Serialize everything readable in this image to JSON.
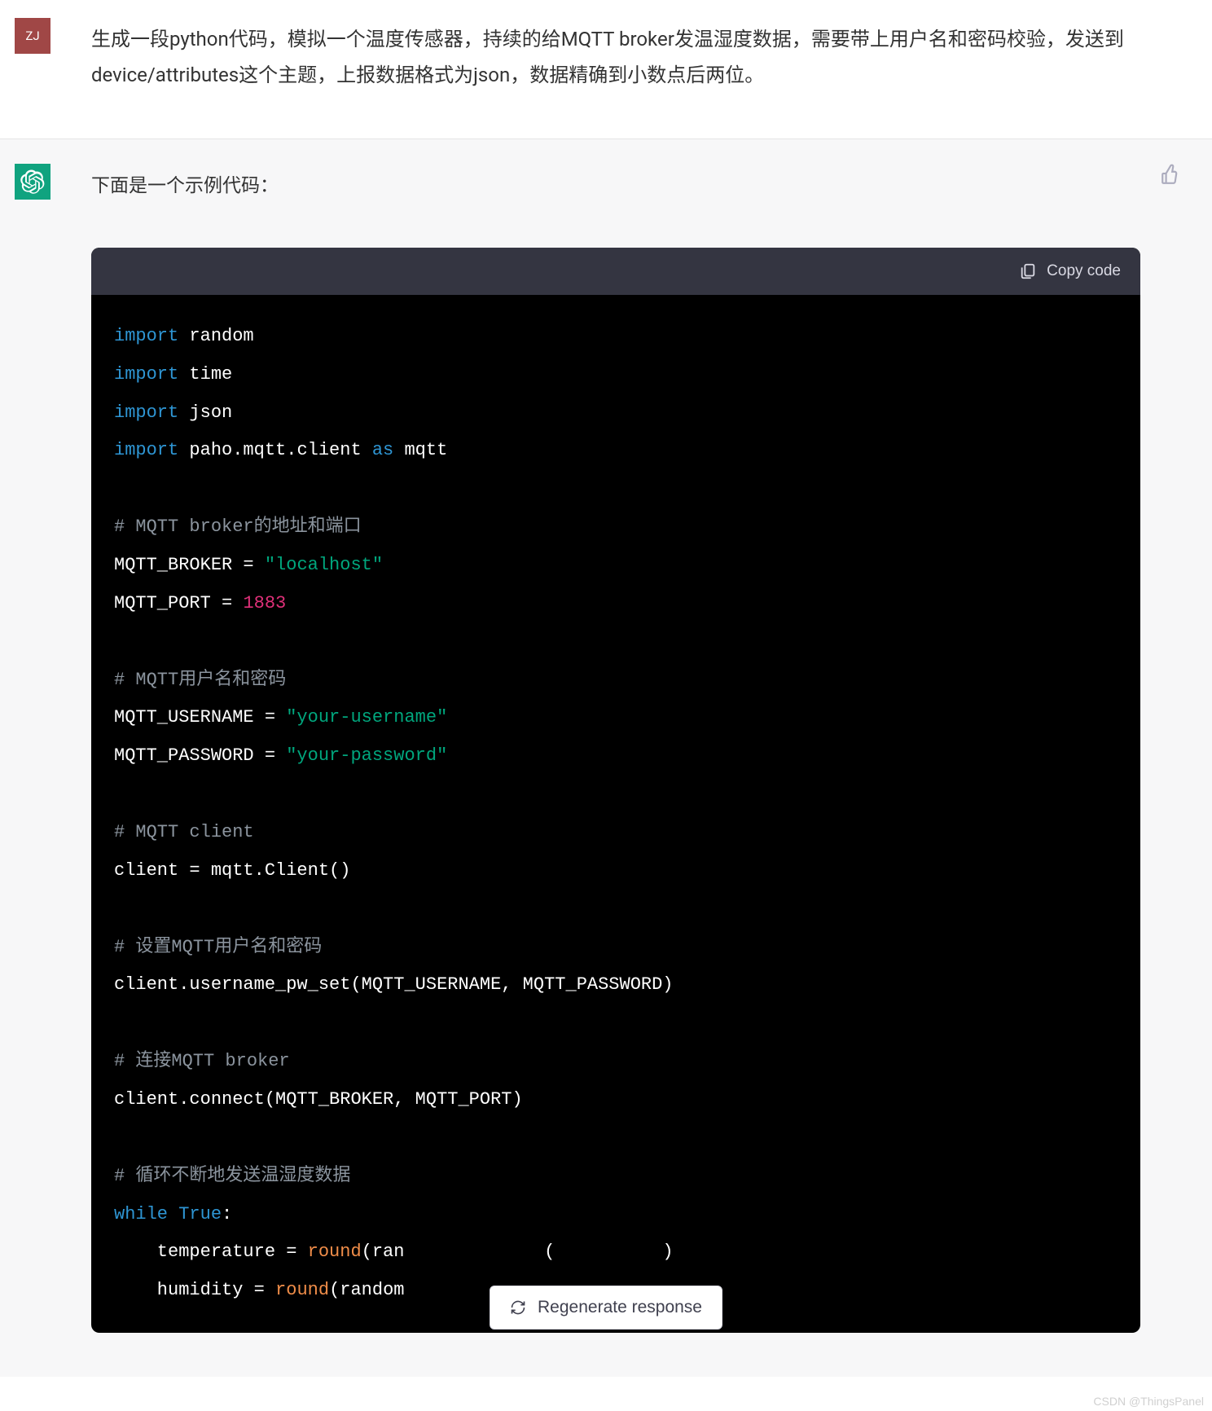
{
  "user": {
    "avatar_text": "ZJ",
    "message": "生成一段python代码，模拟一个温度传感器，持续的给MQTT broker发温湿度数据，需要带上用户名和密码校验，发送到device/attributes这个主题，上报数据格式为json，数据精确到小数点后两位。"
  },
  "assistant": {
    "intro": "下面是一个示例代码：",
    "copy_label": "Copy code",
    "code": {
      "lines": [
        {
          "t": "stmt",
          "parts": [
            {
              "c": "kw",
              "v": "import"
            },
            {
              "c": "id",
              "v": " random"
            }
          ]
        },
        {
          "t": "stmt",
          "parts": [
            {
              "c": "kw",
              "v": "import"
            },
            {
              "c": "id",
              "v": " time"
            }
          ]
        },
        {
          "t": "stmt",
          "parts": [
            {
              "c": "kw",
              "v": "import"
            },
            {
              "c": "id",
              "v": " json"
            }
          ]
        },
        {
          "t": "stmt",
          "parts": [
            {
              "c": "kw",
              "v": "import"
            },
            {
              "c": "id",
              "v": " paho.mqtt.client "
            },
            {
              "c": "kw",
              "v": "as"
            },
            {
              "c": "id",
              "v": " mqtt"
            }
          ]
        },
        {
          "t": "blank"
        },
        {
          "t": "stmt",
          "parts": [
            {
              "c": "cmt",
              "v": "# MQTT broker的地址和端口"
            }
          ]
        },
        {
          "t": "stmt",
          "parts": [
            {
              "c": "id",
              "v": "MQTT_BROKER = "
            },
            {
              "c": "str",
              "v": "\"localhost\""
            }
          ]
        },
        {
          "t": "stmt",
          "parts": [
            {
              "c": "id",
              "v": "MQTT_PORT = "
            },
            {
              "c": "num",
              "v": "1883"
            }
          ]
        },
        {
          "t": "blank"
        },
        {
          "t": "stmt",
          "parts": [
            {
              "c": "cmt",
              "v": "# MQTT用户名和密码"
            }
          ]
        },
        {
          "t": "stmt",
          "parts": [
            {
              "c": "id",
              "v": "MQTT_USERNAME = "
            },
            {
              "c": "str",
              "v": "\"your-username\""
            }
          ]
        },
        {
          "t": "stmt",
          "parts": [
            {
              "c": "id",
              "v": "MQTT_PASSWORD = "
            },
            {
              "c": "str",
              "v": "\"your-password\""
            }
          ]
        },
        {
          "t": "blank"
        },
        {
          "t": "stmt",
          "parts": [
            {
              "c": "cmt",
              "v": "# MQTT client"
            }
          ]
        },
        {
          "t": "stmt",
          "parts": [
            {
              "c": "id",
              "v": "client = mqtt.Client()"
            }
          ]
        },
        {
          "t": "blank"
        },
        {
          "t": "stmt",
          "parts": [
            {
              "c": "cmt",
              "v": "# 设置MQTT用户名和密码"
            }
          ]
        },
        {
          "t": "stmt",
          "parts": [
            {
              "c": "id",
              "v": "client.username_pw_set(MQTT_USERNAME, MQTT_PASSWORD)"
            }
          ]
        },
        {
          "t": "blank"
        },
        {
          "t": "stmt",
          "parts": [
            {
              "c": "cmt",
              "v": "# 连接MQTT broker"
            }
          ]
        },
        {
          "t": "stmt",
          "parts": [
            {
              "c": "id",
              "v": "client.connect(MQTT_BROKER, MQTT_PORT)"
            }
          ]
        },
        {
          "t": "blank"
        },
        {
          "t": "stmt",
          "parts": [
            {
              "c": "cmt",
              "v": "# 循环不断地发送温湿度数据"
            }
          ]
        },
        {
          "t": "stmt",
          "parts": [
            {
              "c": "kw",
              "v": "while"
            },
            {
              "c": "id",
              "v": " "
            },
            {
              "c": "kw",
              "v": "True"
            },
            {
              "c": "id",
              "v": ":"
            }
          ]
        },
        {
          "t": "stmt",
          "parts": [
            {
              "c": "id",
              "v": "    temperature = "
            },
            {
              "c": "fn",
              "v": "round"
            },
            {
              "c": "id",
              "v": "(ran             (          )"
            }
          ]
        },
        {
          "t": "stmt",
          "parts": [
            {
              "c": "id",
              "v": "    humidity = "
            },
            {
              "c": "fn",
              "v": "round"
            },
            {
              "c": "id",
              "v": "(random"
            }
          ]
        }
      ]
    }
  },
  "regenerate_label": "Regenerate response",
  "watermark": "CSDN @ThingsPanel"
}
